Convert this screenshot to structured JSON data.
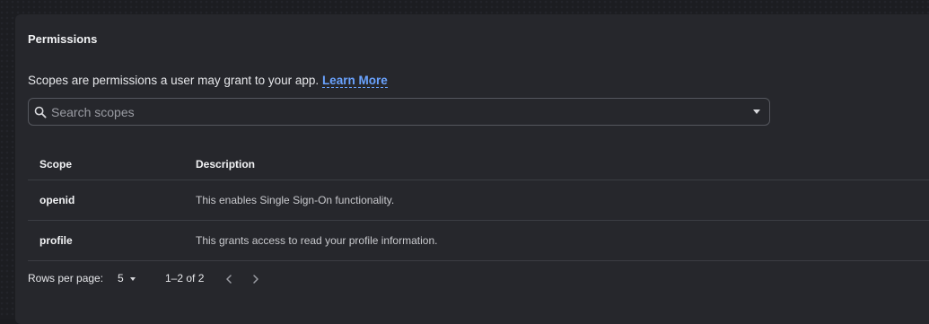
{
  "permissions": {
    "title": "Permissions",
    "intro_text": "Scopes are permissions a user may grant to your app.",
    "learn_more": "Learn More",
    "search": {
      "placeholder": "Search scopes",
      "value": ""
    },
    "table": {
      "columns": [
        "Scope",
        "Description"
      ],
      "rows": [
        {
          "scope": "openid",
          "description": "This enables Single Sign-On functionality."
        },
        {
          "scope": "profile",
          "description": "This grants access to read your profile information."
        }
      ]
    },
    "pagination": {
      "rows_per_page_label": "Rows per page:",
      "rows_per_page_value": "5",
      "range_text": "1–2 of 2"
    }
  },
  "icons": {
    "search": "search-icon",
    "dropdown": "chevron-down-icon",
    "prev": "chevron-left-icon",
    "next": "chevron-right-icon"
  },
  "colors": {
    "background": "#1c1d21",
    "card": "#26272c",
    "link": "#6aa3ff",
    "divider": "#3b3d43"
  }
}
